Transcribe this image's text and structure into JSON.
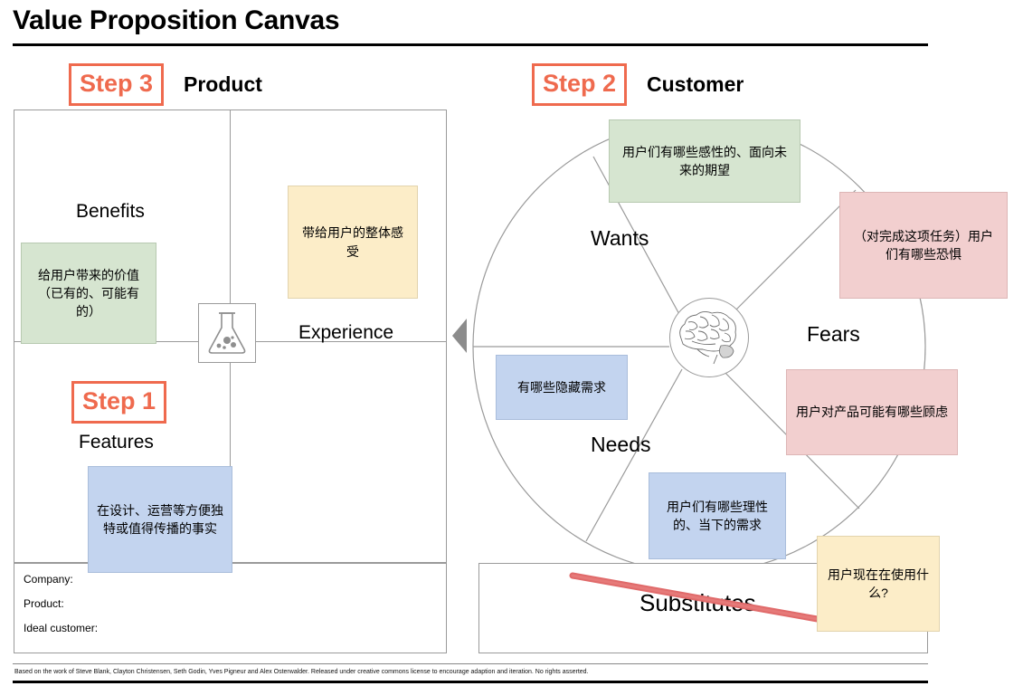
{
  "page": {
    "title": "Value Proposition Canvas",
    "footer": "Based on the work of Steve Blank, Clayton Christensen, Seth Godin, Yves Pigneur and Alex Osterwalder. Released under creative commons license to encourage adaption and iteration. No rights asserted."
  },
  "colors": {
    "accent": "#ef6a4e",
    "strike": "#e06a6a",
    "note_green": "#d6e5d0",
    "note_yellow": "#fcedc8",
    "note_pink": "#f2cfcf",
    "note_blue": "#c3d4ef",
    "line": "#9a9a9a"
  },
  "product": {
    "step_badge": "Step 3",
    "step_title": "Product",
    "step1_badge": "Step 1",
    "labels": {
      "benefits": "Benefits",
      "experience": "Experience",
      "features": "Features"
    },
    "icons": {
      "center": "flask-icon"
    },
    "notes": {
      "benefits": "给用户带来的价值（已有的、可能有的）",
      "experience": "带给用户的整体感受",
      "features": "在设计、运营等方便独特或值得传播的事实"
    },
    "form": {
      "company": "Company:",
      "product": "Product:",
      "ideal_customer": "Ideal customer:"
    }
  },
  "customer": {
    "step_badge": "Step 2",
    "step_title": "Customer",
    "labels": {
      "wants": "Wants",
      "fears": "Fears",
      "needs": "Needs",
      "substitutes": "Substitutes"
    },
    "substitutes_struck_through": true,
    "icons": {
      "center": "brain-icon"
    },
    "notes": {
      "wants": "用户们有哪些感性的、面向未来的期望",
      "fears_top": "（对完成这项任务）用户们有哪些恐惧",
      "fears_bottom": "用户对产品可能有哪些顾虑",
      "needs_hidden": "有哪些隐藏需求",
      "needs_rational": "用户们有哪些理性的、当下的需求",
      "substitutes": "用户现在在使用什么?"
    }
  }
}
